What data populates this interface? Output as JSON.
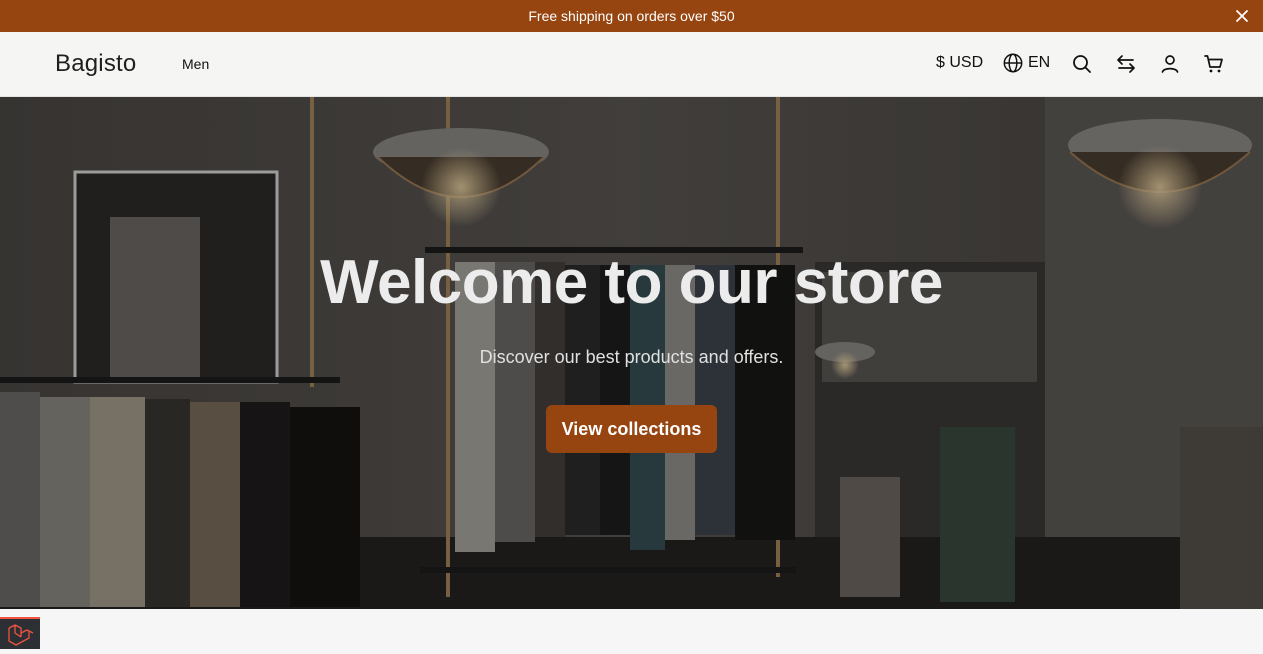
{
  "announcement": {
    "text": "Free shipping on orders over $50"
  },
  "header": {
    "logo": "Bagisto",
    "nav": [
      {
        "label": "Men"
      }
    ],
    "currency": "$ USD",
    "language": "EN",
    "icons": [
      "globe-icon",
      "search-icon",
      "compare-icon",
      "user-icon",
      "cart-icon"
    ]
  },
  "hero": {
    "title": "Welcome to our store",
    "subtitle": "Discover our best products and offers.",
    "cta": "View collections"
  },
  "colors": {
    "brand": "#974510",
    "header_bg": "#f5f5f3"
  }
}
